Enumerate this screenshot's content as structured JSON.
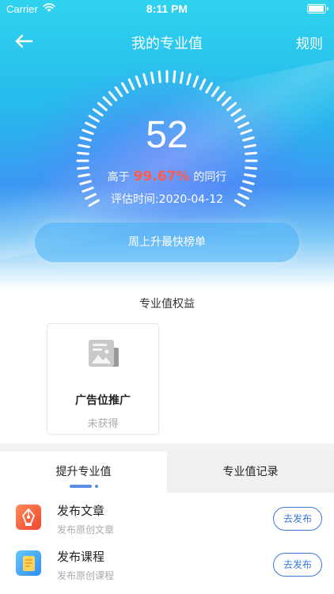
{
  "status_bar": {
    "carrier": "Carrier",
    "time": "8:11 PM"
  },
  "nav": {
    "title": "我的专业值",
    "rules": "规则"
  },
  "score": {
    "value": "52",
    "prefix": "高于",
    "percent": "99.67%",
    "suffix": "的同行",
    "eval_time": "评估时间:2020-04-12"
  },
  "rank_button": "周上升最快榜单",
  "benefits": {
    "title": "专业值权益",
    "items": [
      {
        "name": "广告位推广",
        "status": "未获得"
      }
    ]
  },
  "tabs": [
    {
      "label": "提升专业值"
    },
    {
      "label": "专业值记录"
    }
  ],
  "tasks": [
    {
      "name": "发布文章",
      "desc": "发布原创文章",
      "button": "去发布",
      "icon": "pen-nib-icon"
    },
    {
      "name": "发布课程",
      "desc": "发布原创课程",
      "button": "去发布",
      "icon": "document-icon"
    }
  ],
  "colors": {
    "accent": "#3a78d8",
    "percent": "#ff5b4d",
    "hero_top": "#2fd3ee",
    "hero_mid": "#3b97f2"
  }
}
